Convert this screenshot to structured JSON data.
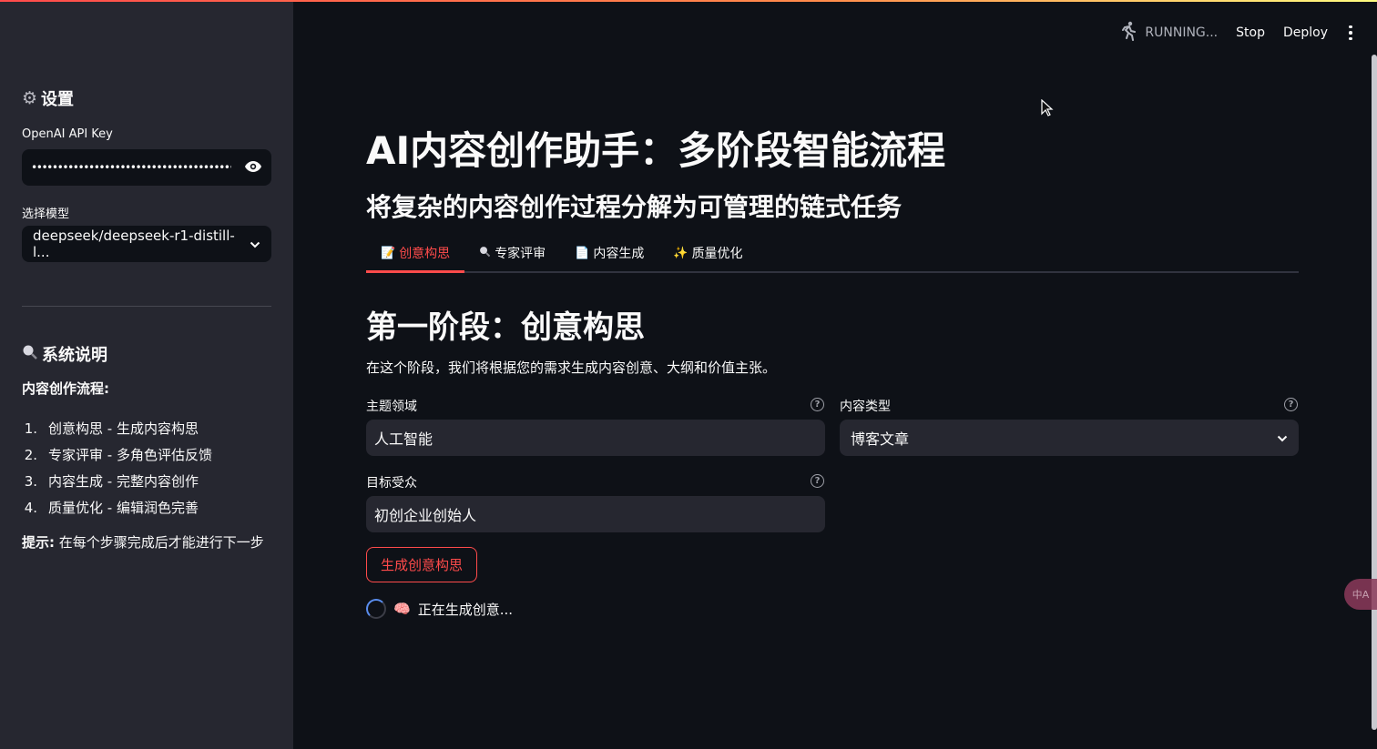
{
  "header": {
    "status": "RUNNING...",
    "stop_label": "Stop",
    "deploy_label": "Deploy"
  },
  "sidebar": {
    "settings_title": "设置",
    "api_key_label": "OpenAI API Key",
    "api_key_value": "••••••••••••••••••••••••••••••••••••••••••••••••",
    "model_label": "选择模型",
    "model_value": "deepseek/deepseek-r1-distill-l...",
    "system_title": "系统说明",
    "flow_title": "内容创作流程:",
    "steps": [
      {
        "num": "1.",
        "text": "创意构思 - 生成内容构思"
      },
      {
        "num": "2.",
        "text": "专家评审 - 多角色评估反馈"
      },
      {
        "num": "3.",
        "text": "内容生成 - 完整内容创作"
      },
      {
        "num": "4.",
        "text": "质量优化 - 编辑润色完善"
      }
    ],
    "tip_bold": "提示:",
    "tip_text": " 在每个步骤完成后才能进行下一步"
  },
  "main": {
    "title": "AI内容创作助手：多阶段智能流程",
    "subtitle": "将复杂的内容创作过程分解为可管理的链式任务",
    "tabs": [
      {
        "label": "创意构思",
        "icon": "memo-icon",
        "active": true
      },
      {
        "label": "专家评审",
        "icon": "magnifier-icon",
        "active": false
      },
      {
        "label": "内容生成",
        "icon": "document-icon",
        "active": false
      },
      {
        "label": "质量优化",
        "icon": "sparkles-icon",
        "active": false
      }
    ],
    "section_title": "第一阶段：创意构思",
    "section_desc": "在这个阶段，我们将根据您的需求生成内容创意、大纲和价值主张。",
    "topic_label": "主题领域",
    "topic_value": "人工智能",
    "content_type_label": "内容类型",
    "content_type_value": "博客文章",
    "audience_label": "目标受众",
    "audience_value": "初创企业创始人",
    "generate_button": "生成创意构思",
    "loading_text": "正在生成创意..."
  },
  "colors": {
    "accent": "#ff4b4b",
    "background": "#0e1117",
    "sidebar": "#262730"
  }
}
